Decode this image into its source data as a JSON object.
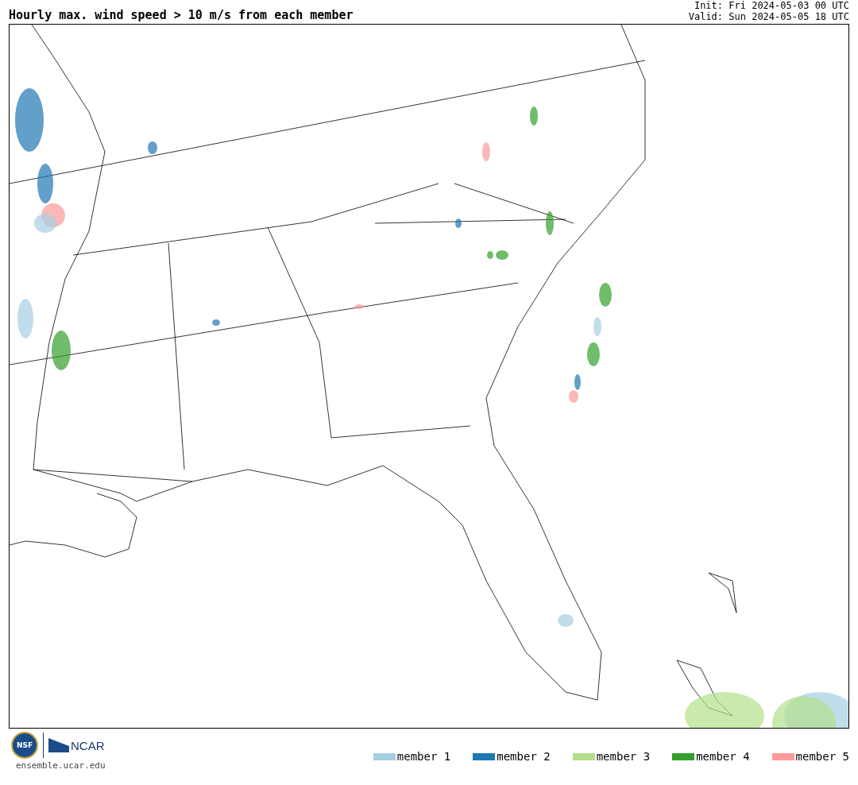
{
  "title": "Hourly max. wind speed > 10 m/s from each member",
  "init": "Init: Fri 2024-05-03 00 UTC",
  "valid": "Valid: Sun 2024-05-05 18 UTC",
  "logos": {
    "nsf": "NSF",
    "ncar": "NCAR",
    "site": "ensemble.ucar.edu"
  },
  "legend": [
    {
      "label": "member 1",
      "color": "#a6cee3"
    },
    {
      "label": "member 2",
      "color": "#1f78b4"
    },
    {
      "label": "member 3",
      "color": "#b2df8a"
    },
    {
      "label": "member 4",
      "color": "#33a02c"
    },
    {
      "label": "member 5",
      "color": "#fb9a99"
    }
  ]
}
